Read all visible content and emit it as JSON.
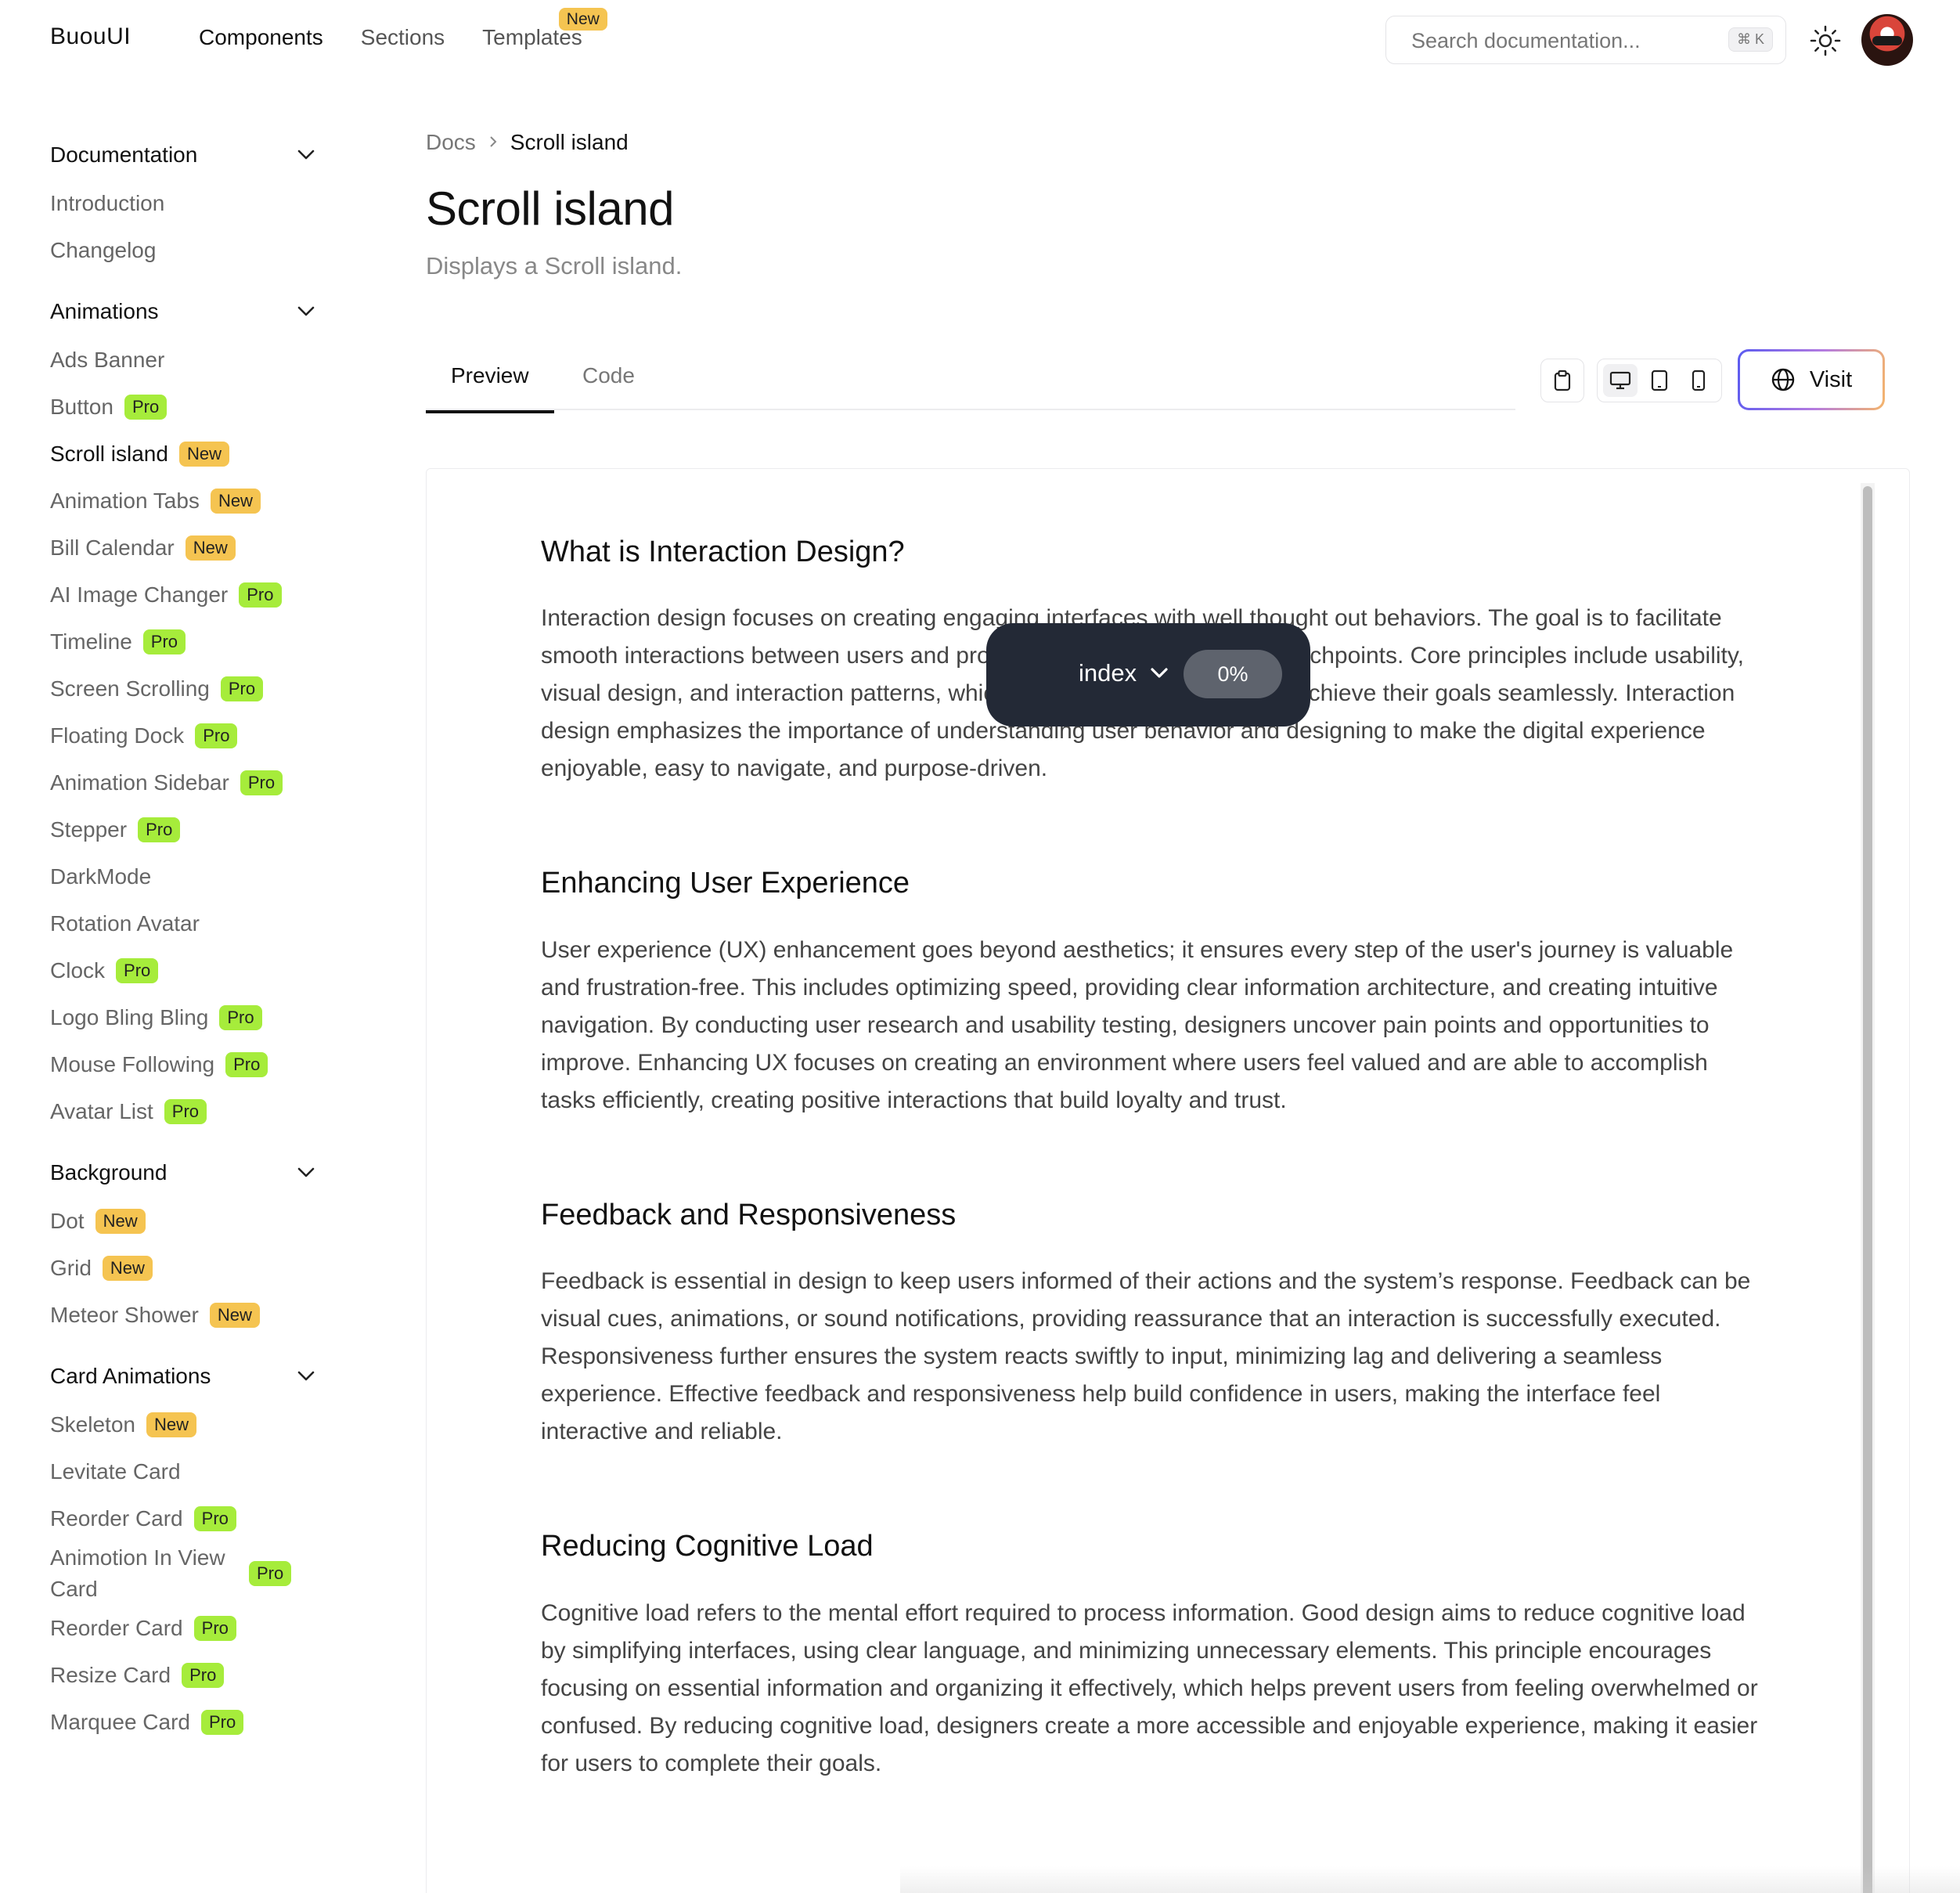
{
  "header": {
    "logo": "BuouUI",
    "nav": [
      {
        "label": "Components"
      },
      {
        "label": "Sections"
      },
      {
        "label": "Templates",
        "badge": "New"
      }
    ],
    "search": {
      "placeholder": "Search documentation...",
      "shortcut": "⌘ K"
    }
  },
  "sidebar": {
    "sections": [
      {
        "title": "Documentation",
        "items": [
          {
            "label": "Introduction"
          },
          {
            "label": "Changelog"
          }
        ]
      },
      {
        "title": "Animations",
        "items": [
          {
            "label": "Ads Banner"
          },
          {
            "label": "Button",
            "badge": "Pro"
          },
          {
            "label": "Scroll island",
            "badge": "New"
          },
          {
            "label": "Animation Tabs",
            "badge": "New"
          },
          {
            "label": "Bill Calendar",
            "badge": "New"
          },
          {
            "label": "AI Image Changer",
            "badge": "Pro"
          },
          {
            "label": "Timeline",
            "badge": "Pro"
          },
          {
            "label": "Screen Scrolling",
            "badge": "Pro"
          },
          {
            "label": "Floating Dock",
            "badge": "Pro"
          },
          {
            "label": "Animation Sidebar",
            "badge": "Pro"
          },
          {
            "label": "Stepper",
            "badge": "Pro"
          },
          {
            "label": "DarkMode"
          },
          {
            "label": "Rotation Avatar"
          },
          {
            "label": "Clock",
            "badge": "Pro"
          },
          {
            "label": "Logo Bling Bling",
            "badge": "Pro"
          },
          {
            "label": "Mouse Following",
            "badge": "Pro"
          },
          {
            "label": "Avatar List",
            "badge": "Pro"
          }
        ]
      },
      {
        "title": "Background",
        "items": [
          {
            "label": "Dot",
            "badge": "New"
          },
          {
            "label": "Grid",
            "badge": "New"
          },
          {
            "label": "Meteor Shower",
            "badge": "New"
          }
        ]
      },
      {
        "title": "Card Animations",
        "items": [
          {
            "label": "Skeleton",
            "badge": "New"
          },
          {
            "label": "Levitate Card"
          },
          {
            "label": "Reorder Card",
            "badge": "Pro"
          },
          {
            "label": "Animotion In View Card",
            "badge": "Pro"
          },
          {
            "label": "Reorder Card",
            "badge": "Pro"
          },
          {
            "label": "Resize Card",
            "badge": "Pro"
          },
          {
            "label": "Marquee Card",
            "badge": "Pro"
          }
        ]
      }
    ]
  },
  "main": {
    "breadcrumb": {
      "parent": "Docs",
      "current": "Scroll island"
    },
    "title": "Scroll island",
    "subtitle": "Displays a Scroll island.",
    "tabs": [
      {
        "label": "Preview"
      },
      {
        "label": "Code"
      }
    ],
    "visit_label": "Visit",
    "article": [
      {
        "heading": "What is Interaction Design?",
        "body": "Interaction design focuses on creating engaging interfaces with well thought out behaviors. The goal is to facilitate smooth interactions between users and products by designing intuitive touchpoints. Core principles include usability, visual design, and interaction patterns, which together ensure that users achieve their goals seamlessly. Interaction design emphasizes the importance of understanding user behavior and designing to make the digital experience enjoyable, easy to navigate, and purpose-driven."
      },
      {
        "heading": "Enhancing User Experience",
        "body": "User experience (UX) enhancement goes beyond aesthetics; it ensures every step of the user's journey is valuable and frustration-free. This includes optimizing speed, providing clear information architecture, and creating intuitive navigation. By conducting user research and usability testing, designers uncover pain points and opportunities to improve. Enhancing UX focuses on creating an environment where users feel valued and are able to accomplish tasks efficiently, creating positive interactions that build loyalty and trust."
      },
      {
        "heading": "Feedback and Responsiveness",
        "body": "Feedback is essential in design to keep users informed of their actions and the system’s response. Feedback can be visual cues, animations, or sound notifications, providing reassurance that an interaction is successfully executed. Responsiveness further ensures the system reacts swiftly to input, minimizing lag and delivering a seamless experience. Effective feedback and responsiveness help build confidence in users, making the interface feel interactive and reliable."
      },
      {
        "heading": "Reducing Cognitive Load",
        "body": "Cognitive load refers to the mental effort required to process information. Good design aims to reduce cognitive load by simplifying interfaces, using clear language, and minimizing unnecessary elements. This principle encourages focusing on essential information and organizing it effectively, which helps prevent users from feeling overwhelmed or confused. By reducing cognitive load, designers create a more accessible and enjoyable experience, making it easier for users to complete their goals."
      }
    ],
    "island": {
      "label": "index",
      "progress": "0%"
    }
  },
  "colors": {
    "pro_badge": "#a6ec3b",
    "new_badge": "#f5c451",
    "island_bg": "#232936",
    "visit_gradient": [
      "#5b5bf0",
      "#b47be0",
      "#f5b56b"
    ]
  },
  "active_item": "Scroll island"
}
